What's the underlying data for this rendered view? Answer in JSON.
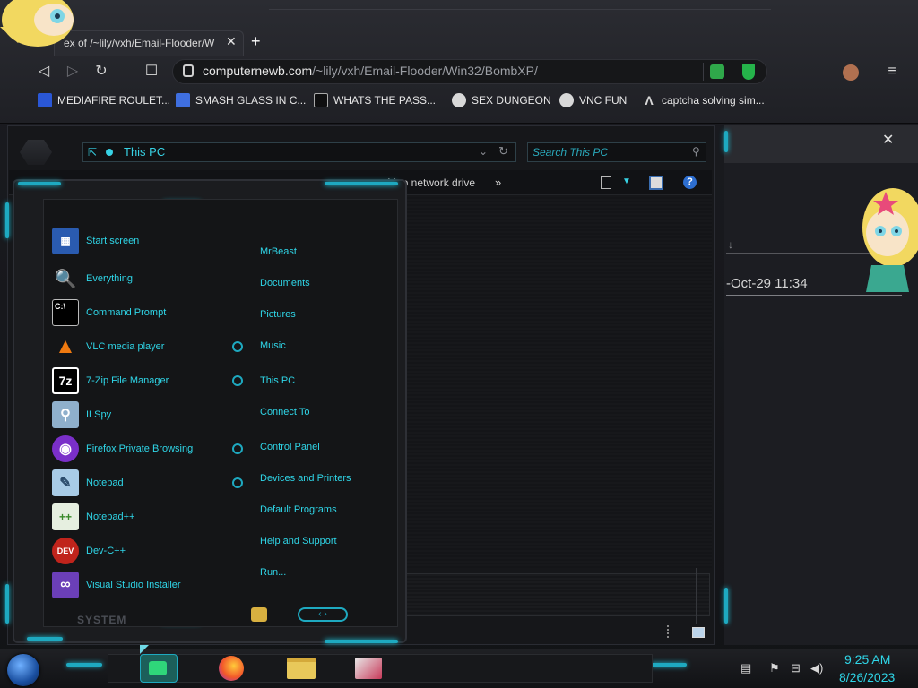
{
  "browser": {
    "tab_title": "ex of /~lily/vxh/Email-Flooder/W",
    "tab_close": "✕",
    "new_tab": "+",
    "back": "◁",
    "forward": "▷",
    "reload": "↻",
    "bookmark_star": "☐",
    "url_host": "computernewb.com",
    "url_path": "/~lily/vxh/Email-Flooder/Win32/BombXP/",
    "menu": "≡",
    "bookmarks": [
      {
        "label": "MEDIAFIRE ROULET...",
        "color": "#2a57d6"
      },
      {
        "label": "SMASH GLASS IN C...",
        "color": "#3f6fe0"
      },
      {
        "label": "WHATS THE PASS...",
        "color": "#222"
      },
      {
        "label": "SEX DUNGEON",
        "color": "#d8d8d8"
      },
      {
        "label": "VNC FUN",
        "color": "#d8d8d8"
      },
      {
        "label": "captcha solving sim...",
        "color": "#1c1d22"
      }
    ]
  },
  "explorer": {
    "address": "This PC",
    "search_placeholder": "Search This PC",
    "toolbar_item": "Map network drive",
    "toolbar_more": "»"
  },
  "side_panel": {
    "close": "✕",
    "date_text": "-Oct-29 11:34"
  },
  "start_menu": {
    "programs": [
      {
        "label": "Start screen",
        "icon": "start-screen-icon",
        "glyph": "▦",
        "bg": "#2a5bb0"
      },
      {
        "label": "Everything",
        "icon": "magnifier-icon",
        "glyph": "🔍",
        "bg": "#b85a10"
      },
      {
        "label": "Command Prompt",
        "icon": "terminal-icon",
        "glyph": "C:\\",
        "bg": "#000000"
      },
      {
        "label": "VLC media player",
        "icon": "cone-icon",
        "glyph": "▲",
        "bg": "#e8700e"
      },
      {
        "label": "7-Zip File Manager",
        "icon": "zip-icon",
        "glyph": "7z",
        "bg": "#000000"
      },
      {
        "label": "ILSpy",
        "icon": "ilspy-icon",
        "glyph": "⚲",
        "bg": "#6c8fb0"
      },
      {
        "label": "Firefox Private Browsing",
        "icon": "private-mask-icon",
        "glyph": "◉",
        "bg": "#7a2fc9"
      },
      {
        "label": "Notepad",
        "icon": "notepad-icon",
        "glyph": "✎",
        "bg": "#8fb6d8"
      },
      {
        "label": "Notepad++",
        "icon": "notepadpp-icon",
        "glyph": "++",
        "bg": "#5aa83a"
      },
      {
        "label": "Dev-C++",
        "icon": "devcpp-icon",
        "glyph": "DEV",
        "bg": "#c0241c"
      },
      {
        "label": "Visual Studio Installer",
        "icon": "vs-icon",
        "glyph": "∞",
        "bg": "#6b3fb8"
      }
    ],
    "places": [
      {
        "label": "MrBeast"
      },
      {
        "label": "Documents"
      },
      {
        "label": "Pictures"
      },
      {
        "label": "Music"
      },
      {
        "label": "This PC"
      },
      {
        "label": "Connect To"
      },
      {
        "label": "Control Panel"
      },
      {
        "label": "Devices and Printers"
      },
      {
        "label": "Default Programs"
      },
      {
        "label": "Help and Support"
      },
      {
        "label": "Run..."
      }
    ],
    "system_label": "SYSTEM",
    "nav_arrows": "‹ ›"
  },
  "taskbar": {
    "time": "9:25 AM",
    "date": "8/26/2023"
  }
}
